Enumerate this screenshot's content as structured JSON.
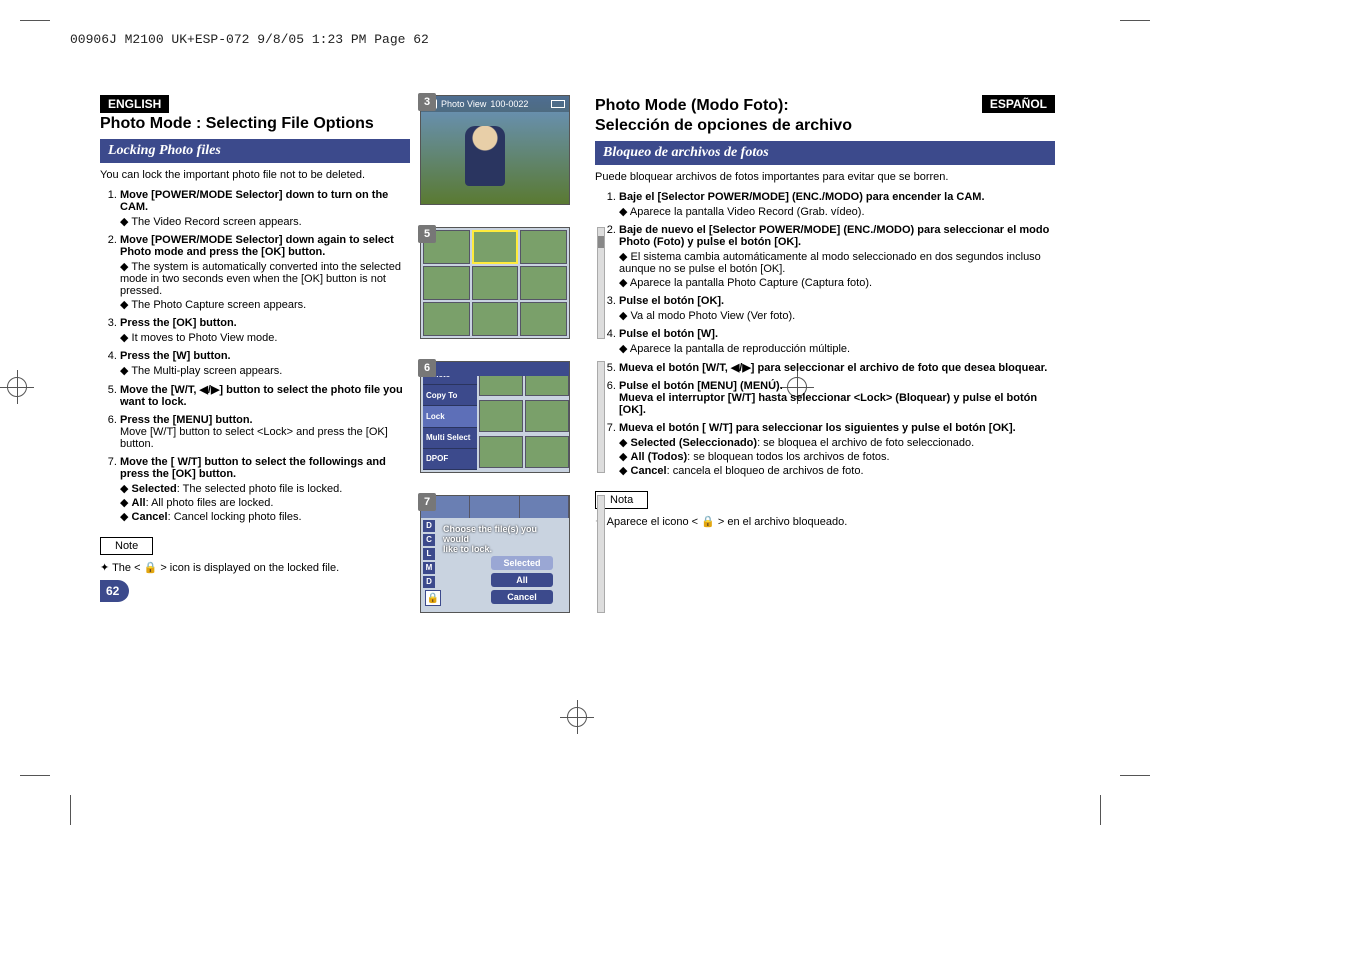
{
  "header_line": "00906J M2100 UK+ESP-072  9/8/05 1:23 PM  Page 62",
  "page_number": "62",
  "english": {
    "lang": "ENGLISH",
    "title": "Photo Mode : Selecting File Options",
    "subtitle": "Locking Photo files",
    "intro": "You can lock the important photo file not to be deleted.",
    "steps": [
      {
        "head": "Move [POWER/MODE Selector] down to turn on the CAM.",
        "bullets": [
          "The Video Record screen appears."
        ]
      },
      {
        "head": "Move [POWER/MODE Selector] down again to select Photo mode and press the [OK] button.",
        "bullets": [
          "The system is automatically converted into the selected mode in two seconds even when the [OK] button is not pressed.",
          "The Photo Capture screen appears."
        ]
      },
      {
        "head": "Press the [OK] button.",
        "bullets": [
          "It moves to Photo View mode."
        ]
      },
      {
        "head": "Press the [W] button.",
        "bullets": [
          "The Multi-play screen appears."
        ]
      },
      {
        "head": "Move the [W/T, ◀/▶] button to select the photo file you want to lock.",
        "bullets": []
      },
      {
        "head": "Press the [MENU] button.",
        "extra": "Move [W/T] button to select <Lock> and press the [OK] button.",
        "bullets": []
      },
      {
        "head": "Move the [ W/T] button to select the followings and press the [OK] button.",
        "bullets": [
          "Selected: The selected photo file is locked.",
          "All: All photo files are locked.",
          "Cancel: Cancel locking photo files."
        ],
        "bullet_keywords": [
          "Selected",
          "All",
          "Cancel"
        ]
      }
    ],
    "note_label": "Note",
    "note_text": "The < 🔒 > icon is displayed on the locked file."
  },
  "spanish": {
    "lang": "ESPAÑOL",
    "title_line1": "Photo Mode (Modo Foto):",
    "title_line2": "Selección de opciones de archivo",
    "subtitle": "Bloqueo de archivos de fotos",
    "intro": "Puede bloquear archivos de fotos importantes para evitar que se borren.",
    "steps": [
      {
        "head": "Baje el [Selector POWER/MODE] (ENC./MODO) para encender la CAM.",
        "bullets": [
          "Aparece la pantalla Video Record (Grab. vídeo)."
        ]
      },
      {
        "head": "Baje de nuevo el [Selector POWER/MODE] (ENC./MODO) para seleccionar el modo Photo (Foto) y pulse el botón [OK].",
        "bullets": [
          "El sistema cambia automáticamente al modo seleccionado en dos segundos incluso aunque no se pulse el botón [OK].",
          "Aparece la pantalla Photo Capture (Captura foto)."
        ]
      },
      {
        "head": "Pulse el botón [OK].",
        "bullets": [
          "Va al modo Photo View (Ver foto)."
        ]
      },
      {
        "head": "Pulse el botón [W].",
        "bullets": [
          "Aparece la pantalla de reproducción múltiple."
        ]
      },
      {
        "head": "Mueva el botón [W/T, ◀/▶] para seleccionar el archivo de foto que desea bloquear.",
        "bullets": []
      },
      {
        "head": "Pulse el botón [MENU] (MENÚ).",
        "extra": "Mueva el interruptor [W/T] hasta seleccionar <Lock> (Bloquear) y pulse el botón [OK].",
        "bullets": []
      },
      {
        "head": "Mueva el botón [ W/T] para seleccionar los siguientes y pulse el botón [OK].",
        "bullets": [
          "Selected (Seleccionado): se bloquea el archivo de foto seleccionado.",
          "All (Todos): se bloquean todos los archivos de fotos.",
          "Cancel: cancela el bloqueo de archivos de foto."
        ],
        "bullet_keywords": [
          "Selected (Seleccionado)",
          "All (Todos)",
          "Cancel"
        ]
      }
    ],
    "note_label": "Nota",
    "note_text": "Aparece el icono < 🔒 > en el archivo bloqueado."
  },
  "device_ui": {
    "shot3": {
      "num": "3",
      "topbar_label": "Photo View",
      "topbar_counter": "100-0022"
    },
    "shot5": {
      "num": "5"
    },
    "shot6": {
      "num": "6",
      "menu": [
        "Delete",
        "Copy To",
        "Lock",
        "Multi Select",
        "DPOF"
      ],
      "selected_index": 2
    },
    "shot7": {
      "num": "7",
      "side_letters": [
        "D",
        "C",
        "L",
        "M",
        "D"
      ],
      "message_line1": "Choose the file(s) you would",
      "message_line2": "like to lock.",
      "options": [
        "Selected",
        "All",
        "Cancel"
      ],
      "lock_glyph": "🔒"
    }
  }
}
